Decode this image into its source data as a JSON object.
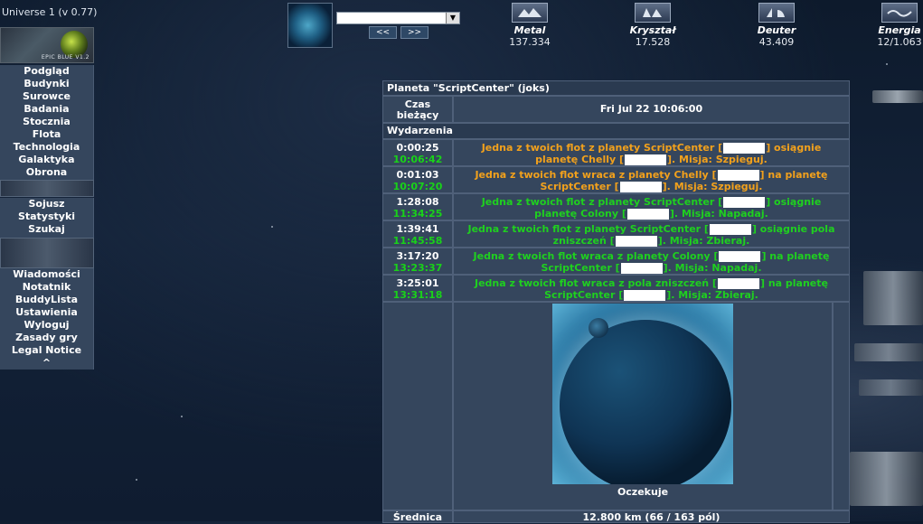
{
  "app": {
    "version": "Universe 1 (v 0.77)"
  },
  "skin_banner": {
    "text": "EPIC BLUE V1.2"
  },
  "menu": {
    "group1": [
      "Podgląd",
      "Budynki",
      "Surowce",
      "Badania",
      "Stocznia",
      "Flota",
      "Technologia",
      "Galaktyka",
      "Obrona"
    ],
    "group2": [
      "Sojusz",
      "Statystyki",
      "Szukaj"
    ],
    "group3": [
      "Wiadomości",
      "Notatnik",
      "BuddyLista",
      "Ustawienia",
      "Wyloguj",
      "Zasady gry",
      "Legal Notice",
      "^"
    ]
  },
  "header": {
    "prev_label": "<<",
    "next_label": ">>",
    "resources": [
      {
        "name": "Metal",
        "value": "137.334",
        "icon": "metal-icon"
      },
      {
        "name": "Kryształ",
        "value": "17.528",
        "icon": "crystal-icon"
      },
      {
        "name": "Deuter",
        "value": "43.409",
        "icon": "deuterium-icon"
      },
      {
        "name": "Energia",
        "value": "12/1.063",
        "icon": "energy-icon"
      }
    ]
  },
  "overview": {
    "title": "Planeta \"ScriptCenter\" (joks)",
    "time_label": "Czas bieżący",
    "time_value": "Fri Jul 22 10:06:00",
    "events_header": "Wydarzenia",
    "events": [
      {
        "countdown": "0:00:25",
        "arrival": "10:06:42",
        "color": "orange",
        "pre": "Jedna z twoich flot z planety ScriptCenter [",
        "mid": "] osiągnie planetę Chelly [",
        "post": "]. Misja: Szpieguj."
      },
      {
        "countdown": "0:01:03",
        "arrival": "10:07:20",
        "color": "orange",
        "pre": "Jedna z twoich flot wraca z planety Chelly [",
        "mid": "] na planetę ScriptCenter [",
        "post": "]. Misja: Szpieguj."
      },
      {
        "countdown": "1:28:08",
        "arrival": "11:34:25",
        "color": "green",
        "pre": "Jedna z twoich flot z planety ScriptCenter [",
        "mid": "] osiągnie planetę Colony [",
        "post": "]. Misja: Napadaj."
      },
      {
        "countdown": "1:39:41",
        "arrival": "11:45:58",
        "color": "green",
        "pre": "Jedna z twoich flot z planety ScriptCenter [",
        "mid": "] osiągnie pola zniszczeń [",
        "post": "]. Misja: Zbieraj."
      },
      {
        "countdown": "3:17:20",
        "arrival": "13:23:37",
        "color": "green",
        "pre": "Jedna z twoich flot wraca z planety Colony [",
        "mid": "] na planetę ScriptCenter [",
        "post": "]. Misja: Napadaj."
      },
      {
        "countdown": "3:25:01",
        "arrival": "13:31:18",
        "color": "green",
        "pre": "Jedna z twoich flot wraca z pola zniszczeń [",
        "mid": "] na planetę ScriptCenter [",
        "post": "]. Misja: Zbieraj."
      }
    ],
    "planet_status": "Oczekuje",
    "diameter_label": "Średnica",
    "diameter_value": "12.800 km (66 / 163 pól)"
  },
  "colors": {
    "panel": "#35465d",
    "orange_event": "#f2a11c",
    "green_event": "#1fd01f"
  }
}
